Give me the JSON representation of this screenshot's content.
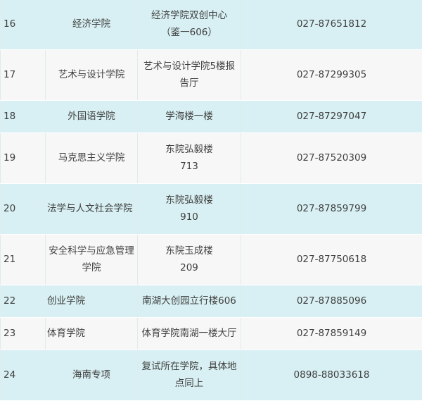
{
  "rows": [
    {
      "no": "16",
      "college": "经济学院",
      "location": [
        "经济学院双创中心",
        "（鉴一606）"
      ],
      "phone": "027-87651812"
    },
    {
      "no": "17",
      "college": "艺术与设计学院",
      "location": [
        "艺术与设计学院5楼报",
        "告厅"
      ],
      "phone": "027-87299305"
    },
    {
      "no": "18",
      "college": "外国语学院",
      "location": [
        "学海楼一楼"
      ],
      "phone": "027-87297047"
    },
    {
      "no": "19",
      "college": "马克思主义学院",
      "location": [
        "东院弘毅楼",
        "713"
      ],
      "phone": "027-87520309"
    },
    {
      "no": "20",
      "college": "法学与人文社会学院",
      "location": [
        "东院弘毅楼",
        "910"
      ],
      "phone": "027-87859799"
    },
    {
      "no": "21",
      "college": "安全科学与应急管理学院",
      "location": [
        "东院玉成楼",
        "209"
      ],
      "phone": "027-87750618"
    },
    {
      "no": "22",
      "college": "创业学院",
      "location": [
        "南湖大创园立行楼606"
      ],
      "phone": "027-87885096"
    },
    {
      "no": "23",
      "college": "体育学院",
      "location": [
        "体育学院南湖一楼大厅"
      ],
      "phone": "027-87859149"
    },
    {
      "no": "24",
      "college": "海南专项",
      "location": [
        "复试所在学院，具体地",
        "点同上"
      ],
      "phone": "0898-88033618"
    }
  ]
}
